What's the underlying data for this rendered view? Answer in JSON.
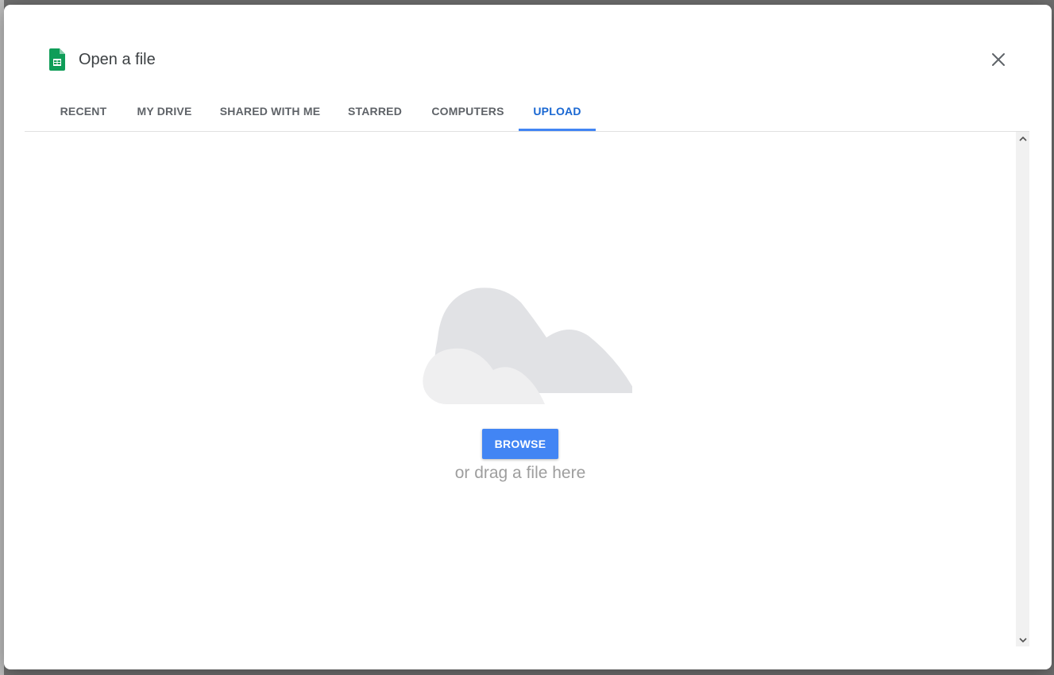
{
  "dialog": {
    "title": "Open a file",
    "app_icon": "google-sheets-icon",
    "close_icon": "close-icon"
  },
  "tabs": [
    {
      "label": "RECENT",
      "active": false
    },
    {
      "label": "MY DRIVE",
      "active": false
    },
    {
      "label": "SHARED WITH ME",
      "active": false
    },
    {
      "label": "STARRED",
      "active": false
    },
    {
      "label": "COMPUTERS",
      "active": false
    },
    {
      "label": "UPLOAD",
      "active": true
    }
  ],
  "upload": {
    "illustration": "cloud-icon",
    "browse_label": "BROWSE",
    "drag_text": "or drag a file here"
  },
  "colors": {
    "accent": "#4285f4",
    "active_tab_text": "#1967d2",
    "tab_text": "#5f6368",
    "sheets_green": "#0f9d58"
  }
}
